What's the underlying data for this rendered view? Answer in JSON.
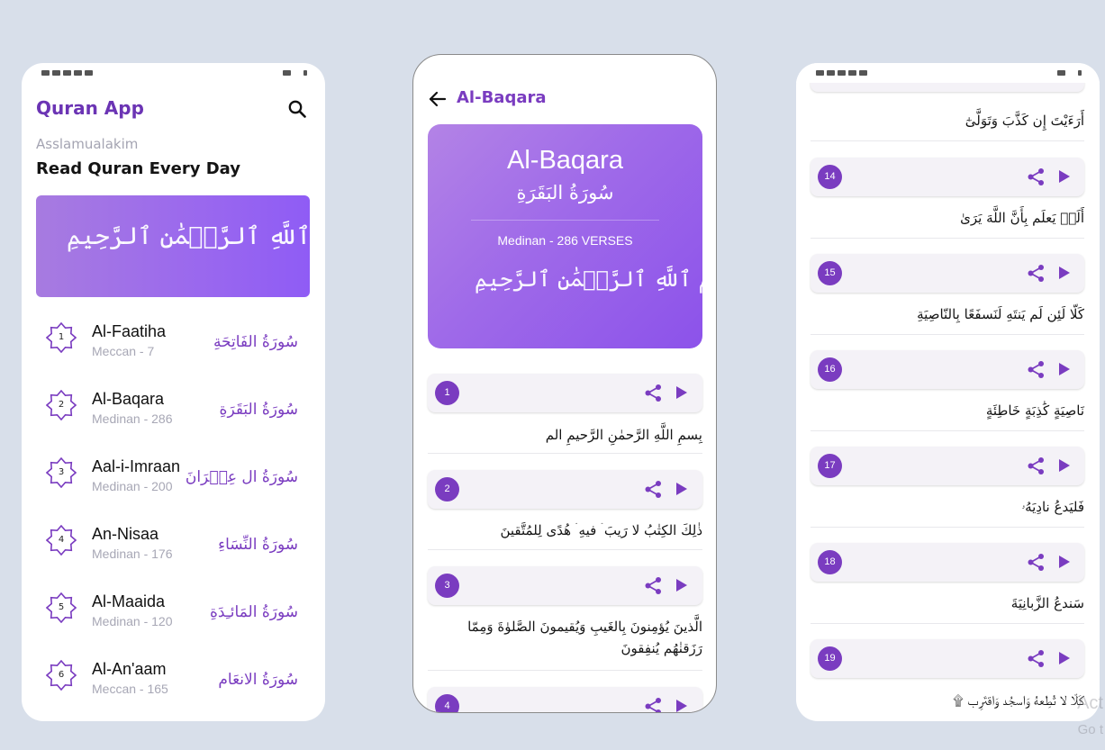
{
  "accent": "#7a3cc0",
  "home": {
    "app_title": "Quran App",
    "greeting": "Asslamualakim",
    "headline": "Read Quran Every Day",
    "banner_text": "بِسۡمِ ٱللَّهِ ٱلرَّحۡمَٰنِ ٱلرَّحِيمِ",
    "surahs": [
      {
        "number": "1",
        "name": "Al-Faatiha",
        "meta": "Meccan - 7",
        "arabic": "سُورَةُ الفَاتِحَةِ"
      },
      {
        "number": "2",
        "name": "Al-Baqara",
        "meta": "Medinan - 286",
        "arabic": "سُورَةُ البَقَرَةِ"
      },
      {
        "number": "3",
        "name": "Aal-i-Imraan",
        "meta": "Medinan - 200",
        "arabic": "سُورَةُ ال عِمۡرَانَ"
      },
      {
        "number": "4",
        "name": "An-Nisaa",
        "meta": "Medinan - 176",
        "arabic": "سُورَةُ النِّسَاءِ"
      },
      {
        "number": "5",
        "name": "Al-Maaida",
        "meta": "Medinan - 120",
        "arabic": "سُورَةُ المَائـِدَةِ"
      },
      {
        "number": "6",
        "name": "Al-An'aam",
        "meta": "Meccan - 165",
        "arabic": "سُورَةُ الانعَام"
      }
    ]
  },
  "detail": {
    "title": "Al-Baqara",
    "card_en": "Al-Baqara",
    "card_ar": "سُورَةُ البَقَرَةِ",
    "card_meta": "Medinan - 286 VERSES",
    "card_bismillah": "بِسۡمِ ٱللَّهِ ٱلرَّحۡمَٰنِ ٱلرَّحِيمِ",
    "verses": [
      {
        "number": "1",
        "text": "بِسمِ اللَّهِ الرَّحمٰنِ الرَّحيمِ الم"
      },
      {
        "number": "2",
        "text": "ذٰلِكَ الكِتٰبُ لا رَيبَ ۛ فيهِ ۛ هُدًى لِلمُتَّقينَ"
      },
      {
        "number": "3",
        "text": "الَّذينَ يُؤمِنونَ بِالغَيبِ وَيُقيمونَ الصَّلوٰةَ وَمِمّا رَزَقنٰهُم يُنفِقونَ"
      },
      {
        "number": "4",
        "text": ""
      }
    ]
  },
  "verses_screen": {
    "top_text": "أَرَءَيْتَ إِن كَذَّبَ وَتَوَلَّىٰٓ",
    "verses": [
      {
        "number": "14",
        "text": "أَلَمۡ يَعلَم بِأَنَّ اللَّهَ يَرَىٰ"
      },
      {
        "number": "15",
        "text": "كَلّا لَئِن لَم يَنتَهِ لَنَسفَعًا بِالنّاصِيَةِ"
      },
      {
        "number": "16",
        "text": "نَاصِيَةٍ كَٰذِبَةٍ خَاطِئَةٍ"
      },
      {
        "number": "17",
        "text": "فَليَدعُ نادِيَهُۥ"
      },
      {
        "number": "18",
        "text": "سَندعُ الزَّبانِيَةَ"
      },
      {
        "number": "19",
        "text": "كَلّا لا تُطِعهُ وَاسجُد وَاقتَرِب ۩"
      }
    ]
  },
  "watermark_line1": "Act",
  "watermark_line2": "Go t"
}
